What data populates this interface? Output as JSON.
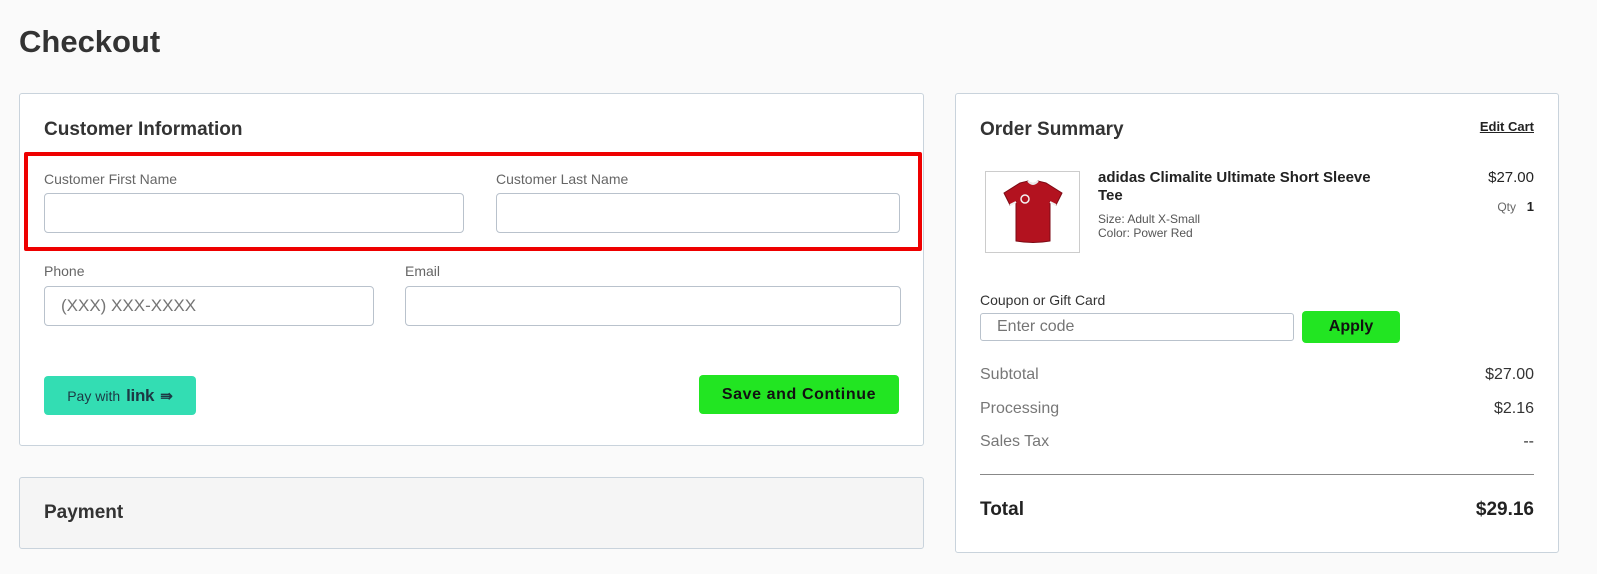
{
  "page": {
    "title": "Checkout"
  },
  "customer": {
    "heading": "Customer Information",
    "first_name": {
      "label": "Customer First Name",
      "value": "",
      "placeholder": ""
    },
    "last_name": {
      "label": "Customer Last Name",
      "value": "",
      "placeholder": ""
    },
    "phone": {
      "label": "Phone",
      "value": "",
      "placeholder": "(XXX) XXX-XXXX"
    },
    "email": {
      "label": "Email",
      "value": "",
      "placeholder": ""
    },
    "link_button": {
      "prefix": "Pay with",
      "brand": "link",
      "arrow": "⇛",
      "color": "#33ddb3"
    },
    "save_button": {
      "label": "Save and Continue",
      "color": "#22e522"
    },
    "highlight_color": "#ee0000"
  },
  "payment": {
    "heading": "Payment"
  },
  "summary": {
    "heading": "Order Summary",
    "edit_cart": "Edit Cart",
    "item": {
      "name": "adidas Climalite Ultimate Short Sleeve Tee",
      "size": "Size: Adult X-Small",
      "color": "Color: Power Red",
      "price": "$27.00",
      "qty_label": "Qty",
      "qty": "1",
      "image_icon": "red-tshirt-image"
    },
    "coupon": {
      "label": "Coupon or Gift Card",
      "placeholder": "Enter code",
      "value": "",
      "apply": "Apply"
    },
    "subtotal": {
      "label": "Subtotal",
      "value": "$27.00"
    },
    "processing": {
      "label": "Processing",
      "value": "$2.16"
    },
    "sales_tax": {
      "label": "Sales Tax",
      "value": "--"
    },
    "total": {
      "label": "Total",
      "value": "$29.16"
    }
  }
}
